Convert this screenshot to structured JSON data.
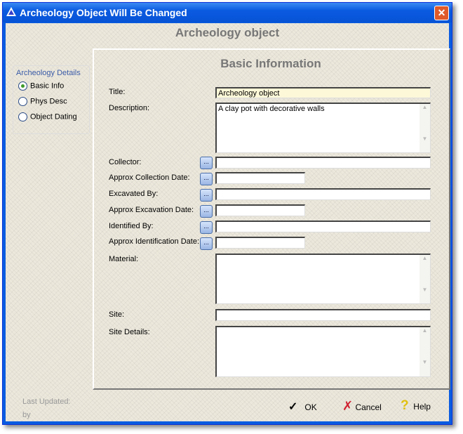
{
  "window": {
    "title": "Archeology Object Will Be Changed",
    "close": "✕"
  },
  "header": "Archeology object",
  "nav": {
    "group_label": "Archeology Details",
    "items": [
      {
        "label": "Basic Info",
        "selected": true
      },
      {
        "label": "Phys Desc",
        "selected": false
      },
      {
        "label": "Object Dating",
        "selected": false
      }
    ]
  },
  "section_title": "Basic Information",
  "fields": {
    "title": {
      "label": "Title:",
      "value": "Archeology object"
    },
    "description": {
      "label": "Description:",
      "value": "A clay pot with decorative walls"
    },
    "collector": {
      "label": "Collector:",
      "value": ""
    },
    "collection_date": {
      "label": "Approx Collection Date:",
      "value": ""
    },
    "excavated_by": {
      "label": "Excavated By:",
      "value": ""
    },
    "excavation_date": {
      "label": "Approx Excavation Date:",
      "value": ""
    },
    "identified_by": {
      "label": "Identified By:",
      "value": ""
    },
    "identification_date": {
      "label": "Approx Identification Date:",
      "value": ""
    },
    "material": {
      "label": "Material:",
      "value": ""
    },
    "site": {
      "label": "Site:",
      "value": ""
    },
    "site_details": {
      "label": "Site Details:",
      "value": ""
    }
  },
  "browse_label": "...",
  "footer": {
    "last_updated": "Last Updated:",
    "by": "by",
    "ok": "OK",
    "cancel": "Cancel",
    "help": "Help"
  }
}
